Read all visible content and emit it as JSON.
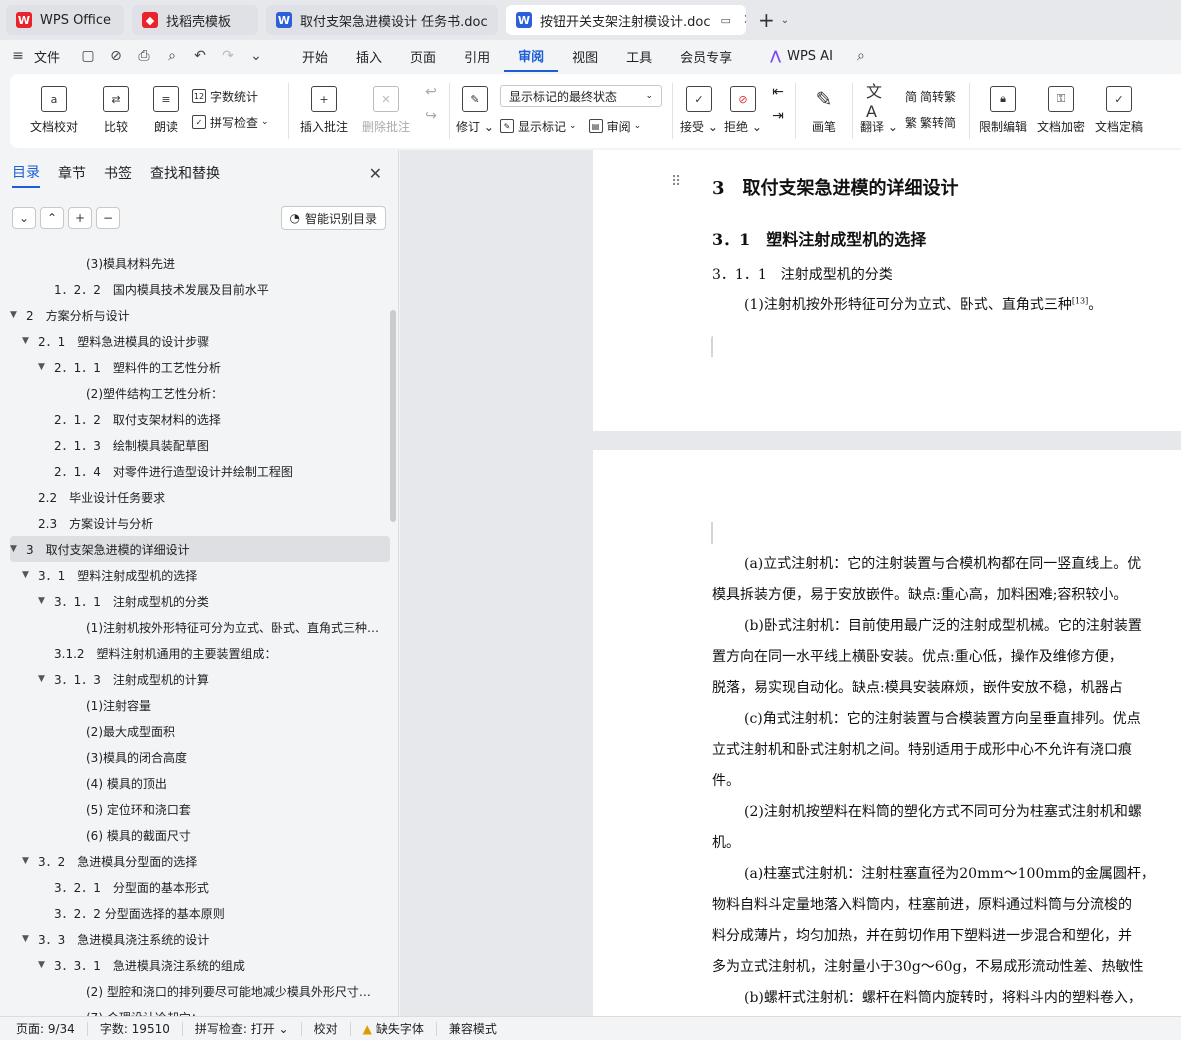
{
  "tabs": [
    {
      "label": "WPS Office",
      "icon": "wps-logo-icon",
      "color": "#e8232b"
    },
    {
      "label": "找稻壳模板",
      "icon": "docer-icon",
      "color": "#e8232b"
    },
    {
      "label": "取付支架急进模设计 任务书.doc",
      "icon": "word-doc-icon",
      "color": "#2b5fd9"
    },
    {
      "label": "按钮开关支架注射模设计.doc",
      "icon": "word-doc-icon",
      "color": "#2b5fd9"
    }
  ],
  "menu": {
    "file": "文件",
    "items": [
      "开始",
      "插入",
      "页面",
      "引用",
      "审阅",
      "视图",
      "工具",
      "会员专享"
    ],
    "active": "审阅",
    "wps_ai": "WPS AI"
  },
  "ribbon": {
    "doc_check": "文档校对",
    "compare": "比较",
    "read_aloud": "朗读",
    "word_count": "字数统计",
    "spell_check": "拼写检查",
    "insert_comment": "插入批注",
    "delete_comment": "删除批注",
    "revise": "修订",
    "markup_state": "显示标记的最终状态",
    "show_markup": "显示标记",
    "review": "审阅",
    "accept": "接受",
    "reject": "拒绝",
    "pen": "画笔",
    "translate": "翻译",
    "to_traditional": "简转繁",
    "trad_to_simp": "繁转简",
    "restrict_edit": "限制编辑",
    "encrypt": "文档加密",
    "finalize": "文档定稿"
  },
  "panel": {
    "tabs": [
      "目录",
      "章节",
      "书签",
      "查找和替换"
    ],
    "smart_toc": "智能识别目录",
    "toc": [
      {
        "text": "(3)模具材料先进",
        "level": 4,
        "arrow": ""
      },
      {
        "text": "1．2．2　国内模具技术发展及目前水平",
        "level": 3,
        "arrow": ""
      },
      {
        "text": "2　方案分析与设计",
        "level": 1,
        "arrow": "▼"
      },
      {
        "text": "2．1　塑料急进模具的设计步骤",
        "level": 2,
        "arrow": "▼"
      },
      {
        "text": "2．1．1　塑料件的工艺性分析",
        "level": 3,
        "arrow": "▼"
      },
      {
        "text": "(2)塑件结构工艺性分析：",
        "level": 4,
        "arrow": ""
      },
      {
        "text": "2．1．2　取付支架材料的选择",
        "level": 3,
        "arrow": ""
      },
      {
        "text": "2．1．3　绘制模具装配草图",
        "level": 3,
        "arrow": ""
      },
      {
        "text": "2．1．4　对零件进行造型设计并绘制工程图",
        "level": 3,
        "arrow": ""
      },
      {
        "text": "2.2　毕业设计任务要求",
        "level": 2,
        "arrow": ""
      },
      {
        "text": "2.3　方案设计与分析",
        "level": 2,
        "arrow": ""
      },
      {
        "text": "3　取付支架急进模的详细设计",
        "level": 1,
        "arrow": "▼"
      },
      {
        "text": "3．1　塑料注射成型机的选择",
        "level": 2,
        "arrow": "▼"
      },
      {
        "text": "3．1．1　注射成型机的分类",
        "level": 3,
        "arrow": "▼"
      },
      {
        "text": "(1)注射机按外形特征可分为立式、卧式、直角式三种…",
        "level": 4,
        "arrow": ""
      },
      {
        "text": "3.1.2　塑料注射机通用的主要装置组成：",
        "level": 3,
        "arrow": ""
      },
      {
        "text": "3．1．3　注射成型机的计算",
        "level": 3,
        "arrow": "▼"
      },
      {
        "text": "(1)注射容量",
        "level": 4,
        "arrow": ""
      },
      {
        "text": "(2)最大成型面积",
        "level": 4,
        "arrow": ""
      },
      {
        "text": "(3)模具的闭合高度",
        "level": 4,
        "arrow": ""
      },
      {
        "text": "(4) 模具的顶出",
        "level": 4,
        "arrow": ""
      },
      {
        "text": "(5) 定位环和浇口套",
        "level": 4,
        "arrow": ""
      },
      {
        "text": "(6) 模具的截面尺寸",
        "level": 4,
        "arrow": ""
      },
      {
        "text": "3．2　急进模具分型面的选择",
        "level": 2,
        "arrow": "▼"
      },
      {
        "text": "3．2．1　分型面的基本形式",
        "level": 3,
        "arrow": ""
      },
      {
        "text": "3．2．2 分型面选择的基本原则",
        "level": 3,
        "arrow": ""
      },
      {
        "text": "3．3　急进模具浇注系统的设计",
        "level": 2,
        "arrow": "▼"
      },
      {
        "text": "3．3．1　急进模具浇注系统的组成",
        "level": 3,
        "arrow": "▼"
      },
      {
        "text": "(2) 型腔和浇口的排列要尽可能地减少模具外形尺寸…",
        "level": 4,
        "arrow": ""
      },
      {
        "text": "(7) 合理设计冷却穴：",
        "level": 4,
        "arrow": ""
      }
    ],
    "selected_index": 11
  },
  "doc": {
    "page1": {
      "h1": "3　取付支架急进模的详细设计",
      "h2": "3．1　塑料注射成型机的选择",
      "h3": "3．1．1　注射成型机的分类",
      "p1": "(1)注射机按外形特征可分为立式、卧式、直角式三种",
      "p1_sup": "[13]",
      "p1_end": "。"
    },
    "page2": [
      "(a)立式注射机：它的注射装置与合模机构都在同一竖直线上。优",
      "模具拆装方便，易于安放嵌件。缺点:重心高，加料困难;容积较小。",
      "(b)卧式注射机：目前使用最广泛的注射成型机械。它的注射装置",
      "置方向在同一水平线上横卧安装。优点:重心低，操作及维修方便，",
      "脱落，易实现自动化。缺点:模具安装麻烦，嵌件安放不稳，机器占",
      "(c)角式注射机：它的注射装置与合模装置方向呈垂直排列。优点",
      "立式注射机和卧式注射机之间。特别适用于成形中心不允许有浇口痕",
      "件。",
      "(2)注射机按塑料在料筒的塑化方式不同可分为柱塞式注射机和螺",
      "机。",
      "(a)柱塞式注射机：注射柱塞直径为20mm～100mm的金属圆杆，",
      "物料自料斗定量地落入料筒内，柱塞前进，原料通过料筒与分流梭的",
      "料分成薄片，均匀加热，并在剪切作用下塑料进一步混合和塑化，并",
      "多为立式注射机，注射量小于30g～60g，不易成形流动性差、热敏性",
      "(b)螺杆式注射机：螺杆在料筒内旋转时，将料斗内的塑料卷入，"
    ]
  },
  "status": {
    "page": "页面: 9/34",
    "words": "字数: 19510",
    "spell": "拼写检查: 打开",
    "proof": "校对",
    "missing_font": "缺失字体",
    "compat": "兼容模式"
  }
}
